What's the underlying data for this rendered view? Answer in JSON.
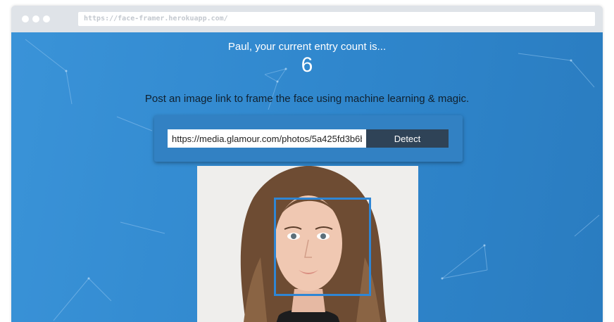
{
  "browser": {
    "url": "https://face-framer.herokuapp.com/"
  },
  "app": {
    "greeting": "Paul, your current entry count is...",
    "entry_count": "6",
    "tagline": "Post an image link to frame the face using machine learning & magic.",
    "form": {
      "image_url_value": "https://media.glamour.com/photos/5a425fd3b6bc",
      "detect_label": "Detect"
    }
  },
  "colors": {
    "background": "#2f86cc",
    "panel": "#3281c3",
    "button": "#2f4357",
    "face_box": "#2f86d4"
  }
}
